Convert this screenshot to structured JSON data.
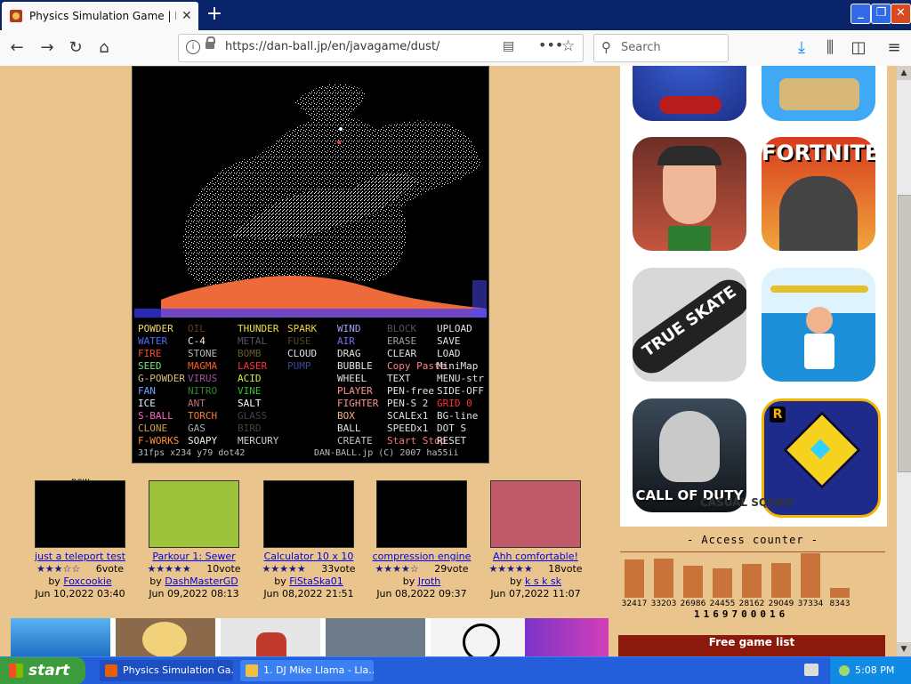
{
  "browser": {
    "tab_title": "Physics Simulation Game | Powder",
    "tab_close": "✕",
    "new_tab": "+",
    "url": "https://dan-ball.jp/en/javagame/dust/",
    "search_placeholder": "Search"
  },
  "game": {
    "palette": [
      {
        "items": [
          {
            "t": "POWDER",
            "c": "#f5d56b"
          },
          {
            "t": "WATER",
            "c": "#4f6cff"
          },
          {
            "t": "FIRE",
            "c": "#ff4a2a"
          },
          {
            "t": "SEED",
            "c": "#7fe07a"
          },
          {
            "t": "G-POWDER",
            "c": "#d7c07a"
          },
          {
            "t": "FAN",
            "c": "#6fa0ff"
          },
          {
            "t": "ICE",
            "c": "#e8ecff"
          },
          {
            "t": "S-BALL",
            "c": "#ff60c0"
          },
          {
            "t": "CLONE",
            "c": "#c9a24a"
          },
          {
            "t": "F-WORKS",
            "c": "#ff8e3a"
          }
        ]
      },
      {
        "items": [
          {
            "t": "OIL",
            "c": "#6a3a1a"
          },
          {
            "t": "C-4",
            "c": "#f4f0d0"
          },
          {
            "t": "STONE",
            "c": "#b9b9b9"
          },
          {
            "t": "MAGMA",
            "c": "#ff5a20"
          },
          {
            "t": "VIRUS",
            "c": "#a050a0"
          },
          {
            "t": "NITRO",
            "c": "#2a8a2a"
          },
          {
            "t": "ANT",
            "c": "#c07070"
          },
          {
            "t": "TORCH",
            "c": "#ff7a30"
          },
          {
            "t": "GAS",
            "c": "#aaaaaa"
          },
          {
            "t": "SOAPY",
            "c": "#f0f0e0"
          }
        ]
      },
      {
        "items": [
          {
            "t": "THUNDER",
            "c": "#f0e040"
          },
          {
            "t": "METAL",
            "c": "#555566"
          },
          {
            "t": "BOMB",
            "c": "#6a5a2a"
          },
          {
            "t": "LASER",
            "c": "#ff3030"
          },
          {
            "t": "ACID",
            "c": "#d0f040"
          },
          {
            "t": "VINE",
            "c": "#30c030"
          },
          {
            "t": "SALT",
            "c": "#ffffff"
          },
          {
            "t": "GLASS",
            "c": "#404050"
          },
          {
            "t": "BIRD",
            "c": "#504038"
          },
          {
            "t": "MERCURY",
            "c": "#d0d0d0"
          }
        ]
      },
      {
        "items": [
          {
            "t": "SPARK",
            "c": "#f0d040"
          },
          {
            "t": "FUSE",
            "c": "#554422"
          },
          {
            "t": "CLOUD",
            "c": "#e0e0e0"
          },
          {
            "t": "PUMP",
            "c": "#3a4a90"
          }
        ]
      },
      {
        "items": [
          {
            "t": "WIND",
            "c": "#a0a0ff"
          },
          {
            "t": "AIR",
            "c": "#7070ff"
          },
          {
            "t": "DRAG",
            "c": "#e0e0e0"
          },
          {
            "t": "BUBBLE",
            "c": "#e0e0e0"
          },
          {
            "t": "WHEEL",
            "c": "#e0e0e0"
          },
          {
            "t": "PLAYER",
            "c": "#ff9090"
          },
          {
            "t": "FIGHTER",
            "c": "#ff9090"
          },
          {
            "t": "BOX",
            "c": "#ffb080"
          },
          {
            "t": "BALL",
            "c": "#e0e0e0"
          },
          {
            "t": "CREATE",
            "c": "#c0c0c0"
          }
        ]
      },
      {
        "items": [
          {
            "t": "BLOCK",
            "c": "#505060"
          },
          {
            "t": "ERASE",
            "c": "#a0a0a0"
          },
          {
            "t": "CLEAR",
            "c": "#e0e0e0"
          },
          {
            "t": "Copy Paste",
            "c": "#ff8080"
          },
          {
            "t": "TEXT",
            "c": "#e0e0e0"
          },
          {
            "t": "PEN-free",
            "c": "#e0e0e0"
          },
          {
            "t": "PEN-S 2",
            "c": "#e0e0e0"
          },
          {
            "t": "SCALEx1",
            "c": "#e0e0e0"
          },
          {
            "t": "SPEEDx1",
            "c": "#e0e0e0"
          },
          {
            "t": "Start Stop",
            "c": "#ff7070"
          }
        ]
      },
      {
        "items": [
          {
            "t": "UPLOAD",
            "c": "#e0e0e0"
          },
          {
            "t": "SAVE",
            "c": "#e0e0e0"
          },
          {
            "t": "LOAD",
            "c": "#e0e0e0"
          },
          {
            "t": "MiniMap",
            "c": "#e0e0e0"
          },
          {
            "t": "MENU-str",
            "c": "#e0e0e0"
          },
          {
            "t": "SIDE-OFF",
            "c": "#e0e0e0"
          },
          {
            "t": "GRID 0",
            "c": "#ff3030"
          },
          {
            "t": "BG-line",
            "c": "#e0e0e0"
          },
          {
            "t": "DOT S",
            "c": "#e0e0e0"
          },
          {
            "t": "RESET",
            "c": "#e0e0e0"
          }
        ]
      }
    ],
    "status_left": "31fps  x234 y79   dot42",
    "status_right": "DAN-BALL.jp (C) 2007 ha55ii"
  },
  "thumbs": [
    {
      "title": "just a teleport test",
      "stars": "★★★☆☆",
      "votes": "6vote",
      "by": "by",
      "author": "Foxcookie",
      "date": "Jun 10,2022 03:40",
      "img": "#000"
    },
    {
      "title": "Parkour 1: Sewer",
      "stars": "★★★★★",
      "votes": "10vote",
      "by": "by",
      "author": "DashMasterGD",
      "date": "Jun 09,2022 08:13",
      "img": "#9ec23a"
    },
    {
      "title": "Calculator 10 x 10",
      "stars": "★★★★★",
      "votes": "33vote",
      "by": "by",
      "author": "FiStaSka01",
      "date": "Jun 08,2022 21:51",
      "img": "#000"
    },
    {
      "title": "compression engine",
      "stars": "★★★★☆",
      "votes": "29vote",
      "by": "by",
      "author": "Jroth",
      "date": "Jun 08,2022 09:37",
      "img": "#000"
    },
    {
      "title": "Ahh comfortable!",
      "stars": "★★★★★",
      "votes": "18vote",
      "by": "by",
      "author": "k s k sk",
      "date": "Jun 07,2022 11:07",
      "img": "#c05a6a"
    }
  ],
  "new_label": "new",
  "ads": {
    "fortnite": "FORTNITE",
    "skate": "TRUE SKATE",
    "cod": "CALL OF DUTY",
    "casual": "CASUAL SQUAD"
  },
  "counter": {
    "title": "- Access counter -",
    "values": [
      32417,
      33203,
      26986,
      24455,
      28162,
      29049,
      37334,
      8343
    ],
    "labels": [
      "32417",
      "33203",
      "26986",
      "24455",
      "28162",
      "29049",
      "37334",
      "8343"
    ],
    "total": "1169700016"
  },
  "free_game_list": "Free game list",
  "taskbar": {
    "start": "start",
    "item1": "Physics Simulation Ga...",
    "item2": "1. DJ Mike Llama - Lla...",
    "time": "5:08 PM"
  }
}
